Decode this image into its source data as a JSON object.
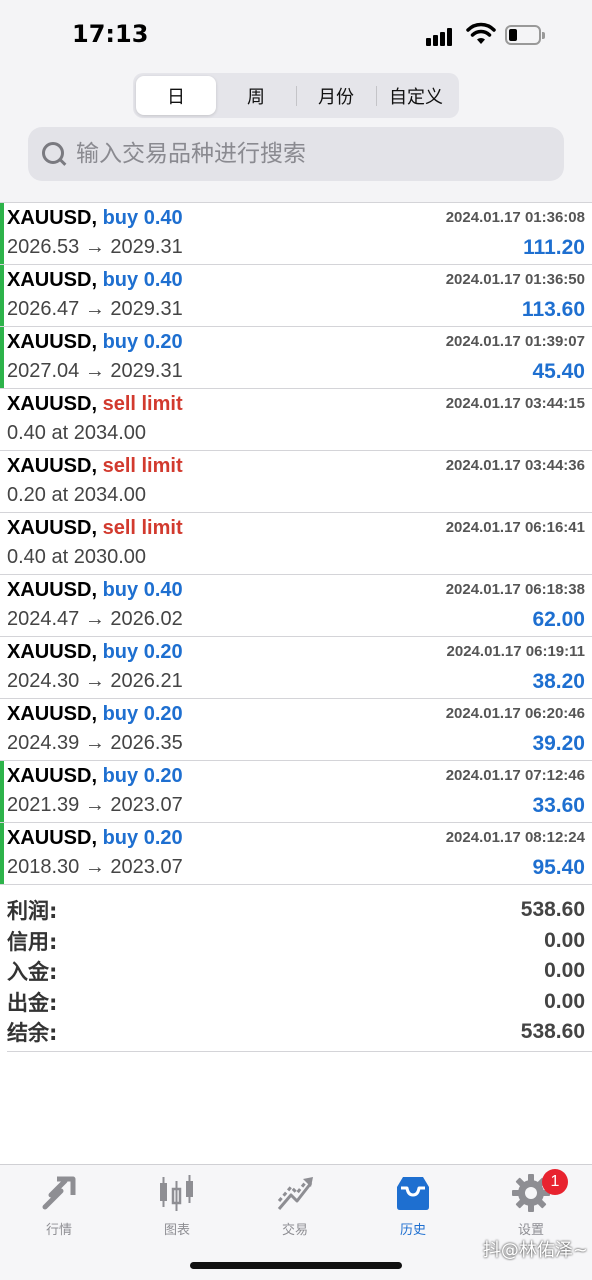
{
  "status_bar": {
    "time": "17:13"
  },
  "period_tabs": [
    "日",
    "周",
    "月份",
    "自定义"
  ],
  "search": {
    "placeholder": "输入交易品种进行搜索"
  },
  "orders": [
    {
      "symbol": "XAUUSD,",
      "type": "buy 0.40",
      "side": "buy",
      "time": "2024.01.17 01:36:08",
      "prices": "2026.53 → 2029.31",
      "profit": "111.20",
      "marked": true
    },
    {
      "symbol": "XAUUSD,",
      "type": "buy 0.40",
      "side": "buy",
      "time": "2024.01.17 01:36:50",
      "prices": "2026.47 → 2029.31",
      "profit": "113.60",
      "marked": true
    },
    {
      "symbol": "XAUUSD,",
      "type": "buy 0.20",
      "side": "buy",
      "time": "2024.01.17 01:39:07",
      "prices": "2027.04 → 2029.31",
      "profit": "45.40",
      "marked": true
    },
    {
      "symbol": "XAUUSD,",
      "type": "sell limit",
      "side": "sell",
      "time": "2024.01.17 03:44:15",
      "prices": "0.40 at 2034.00",
      "profit": "",
      "marked": false
    },
    {
      "symbol": "XAUUSD,",
      "type": "sell limit",
      "side": "sell",
      "time": "2024.01.17 03:44:36",
      "prices": "0.20 at 2034.00",
      "profit": "",
      "marked": false
    },
    {
      "symbol": "XAUUSD,",
      "type": "sell limit",
      "side": "sell",
      "time": "2024.01.17 06:16:41",
      "prices": "0.40 at 2030.00",
      "profit": "",
      "marked": false
    },
    {
      "symbol": "XAUUSD,",
      "type": "buy 0.40",
      "side": "buy",
      "time": "2024.01.17 06:18:38",
      "prices": "2024.47 → 2026.02",
      "profit": "62.00",
      "marked": false
    },
    {
      "symbol": "XAUUSD,",
      "type": "buy 0.20",
      "side": "buy",
      "time": "2024.01.17 06:19:11",
      "prices": "2024.30 → 2026.21",
      "profit": "38.20",
      "marked": false
    },
    {
      "symbol": "XAUUSD,",
      "type": "buy 0.20",
      "side": "buy",
      "time": "2024.01.17 06:20:46",
      "prices": "2024.39 → 2026.35",
      "profit": "39.20",
      "marked": false
    },
    {
      "symbol": "XAUUSD,",
      "type": "buy 0.20",
      "side": "buy",
      "time": "2024.01.17 07:12:46",
      "prices": "2021.39 → 2023.07",
      "profit": "33.60",
      "marked": true
    },
    {
      "symbol": "XAUUSD,",
      "type": "buy 0.20",
      "side": "buy",
      "time": "2024.01.17 08:12:24",
      "prices": "2018.30 → 2023.07",
      "profit": "95.40",
      "marked": true
    }
  ],
  "summary": [
    {
      "label": "利润:",
      "value": "538.60"
    },
    {
      "label": "信用:",
      "value": "0.00"
    },
    {
      "label": "入金:",
      "value": "0.00"
    },
    {
      "label": "出金:",
      "value": "0.00"
    },
    {
      "label": "结余:",
      "value": "538.60"
    }
  ],
  "tab_bar": [
    {
      "label": "行情",
      "icon": "quotes-icon"
    },
    {
      "label": "图表",
      "icon": "chart-icon"
    },
    {
      "label": "交易",
      "icon": "trade-icon"
    },
    {
      "label": "历史",
      "icon": "history-icon"
    },
    {
      "label": "设置",
      "icon": "settings-icon"
    }
  ],
  "settings_badge": "1",
  "watermark": "抖@林佑泽~",
  "colors": {
    "buy": "#1e6fd0",
    "sell": "#d23a2e",
    "marker": "#2db34a",
    "active_tab": "#1e6fd0",
    "badge": "#e8232f"
  }
}
